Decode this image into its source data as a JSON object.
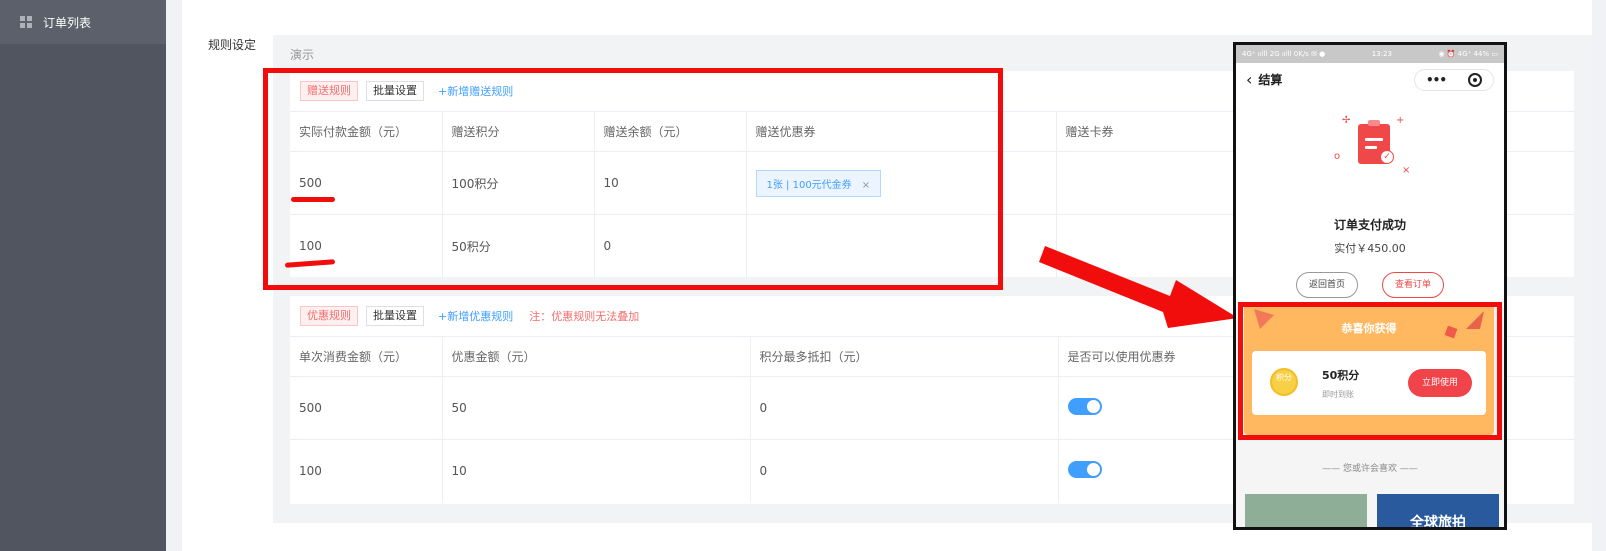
{
  "sidebar": {
    "items": [
      {
        "label": "订单列表",
        "icon": "grid-icon"
      }
    ]
  },
  "rule_label": "规则设定",
  "demo_label": "演示",
  "gift_rules": {
    "tag": "赠送规则",
    "batch_button": "批量设置",
    "add_link": "+新增赠送规则",
    "columns": [
      "实际付款金额（元）",
      "赠送积分",
      "赠送余额（元）",
      "赠送优惠券",
      "赠送卡券"
    ],
    "rows": [
      {
        "amount": "500",
        "points": "100积分",
        "balance": "10",
        "coupon": "1张 | 100元代金券",
        "coupon_close": "×",
        "card": ""
      },
      {
        "amount": "100",
        "points": "50积分",
        "balance": "0",
        "coupon": "",
        "coupon_close": "",
        "card": ""
      }
    ]
  },
  "discount_rules": {
    "tag": "优惠规则",
    "batch_button": "批量设置",
    "add_link": "+新增优惠规则",
    "note": "注：优惠规则无法叠加",
    "columns": [
      "单次消费金额（元）",
      "优惠金额（元）",
      "积分最多抵扣（元）",
      "是否可以使用优惠券"
    ],
    "rows": [
      {
        "amount": "500",
        "discount": "50",
        "max_points": "0",
        "allow_coupon": true
      },
      {
        "amount": "100",
        "discount": "10",
        "max_points": "0",
        "allow_coupon": true
      }
    ]
  },
  "phone": {
    "status_left": "4G⁺ ıılll 2G ıılll 0K/s ✉ ●",
    "status_time": "13:23",
    "status_right": "◉ ⏰ 4G⁺ 44% ▭",
    "nav_title": "结算",
    "back_icon": "‹",
    "more_icon": "•••",
    "target_icon": "record-icon",
    "success_title": "订单支付成功",
    "paid_amount": "实付￥450.00",
    "home_button": "返回首页",
    "order_button": "查看订单",
    "reward_title": "恭喜你获得",
    "coin_label": "积分",
    "reward_name": "50积分",
    "reward_sub": "即时到账",
    "use_button": "立即使用",
    "recommend": "—— 您或许会喜欢 ——",
    "thumb2_text": "全球旅拍"
  },
  "colors": {
    "accent_blue": "#409eff",
    "annotation_red": "#f20d0d",
    "danger": "#f56c6c",
    "sidebar": "#50555f"
  }
}
